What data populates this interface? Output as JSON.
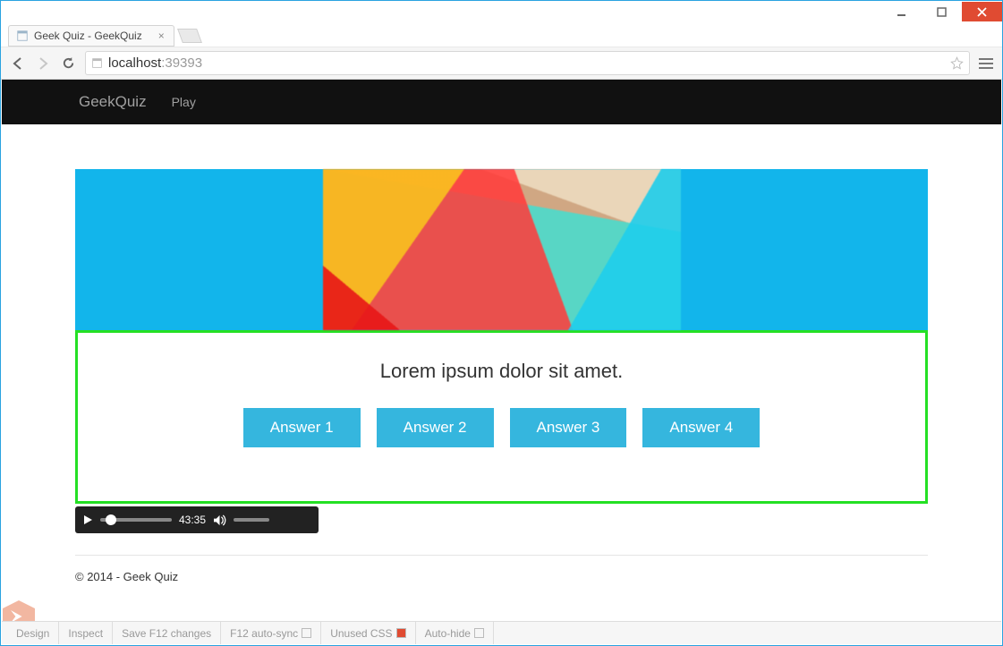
{
  "window": {
    "tab_title": "Geek Quiz - GeekQuiz"
  },
  "address_bar": {
    "host": "localhost",
    "port": ":39393"
  },
  "nav": {
    "brand": "GeekQuiz",
    "links": [
      "Play"
    ]
  },
  "quiz": {
    "question": "Lorem ipsum dolor sit amet.",
    "answers": [
      "Answer 1",
      "Answer 2",
      "Answer 3",
      "Answer 4"
    ]
  },
  "audio": {
    "time": "43:35"
  },
  "footer": {
    "text": "© 2014 - Geek Quiz"
  },
  "browserlink": {
    "items": [
      "Design",
      "Inspect",
      "Save F12 changes",
      "F12 auto-sync",
      "Unused CSS",
      "Auto-hide"
    ],
    "checked_index": 4
  }
}
